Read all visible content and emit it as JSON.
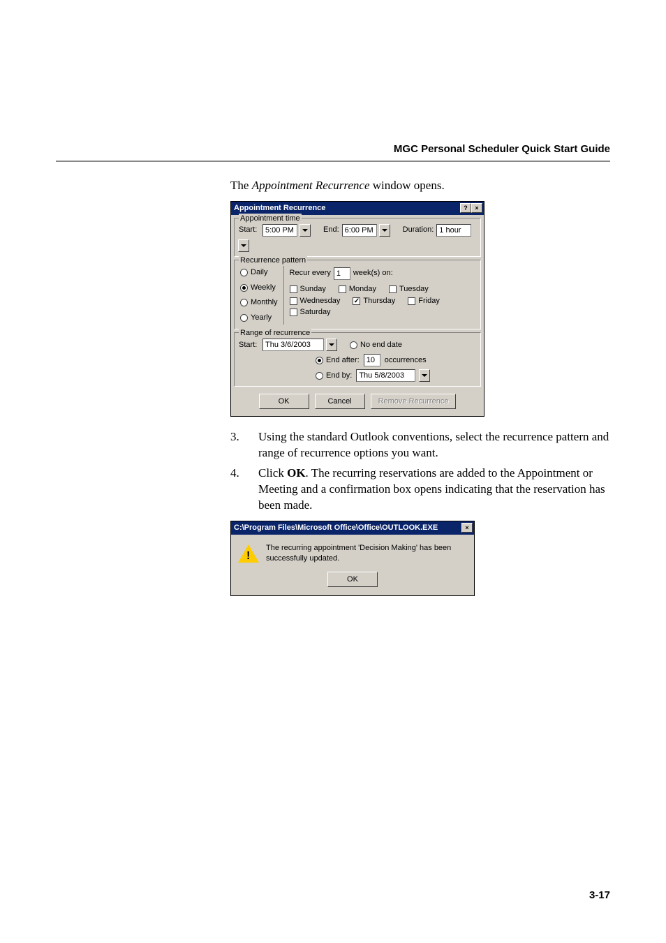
{
  "header": {
    "title": "MGC Personal Scheduler Quick Start Guide"
  },
  "intro": {
    "pre": "The ",
    "italic": "Appointment Recurrence",
    "post": " window opens."
  },
  "dialog1": {
    "title": "Appointment Recurrence",
    "appt": {
      "legend": "Appointment time",
      "startLabel": "Start:",
      "startValue": "5:00 PM",
      "endLabel": "End:",
      "endValue": "6:00 PM",
      "durationLabel": "Duration:",
      "durationValue": "1 hour"
    },
    "pattern": {
      "legend": "Recurrence pattern",
      "daily": "Daily",
      "weekly": "Weekly",
      "monthly": "Monthly",
      "yearly": "Yearly",
      "recurEvery": "Recur every",
      "recurN": "1",
      "weeksOn": "week(s) on:",
      "sunday": "Sunday",
      "monday": "Monday",
      "tuesday": "Tuesday",
      "wednesday": "Wednesday",
      "thursday": "Thursday",
      "friday": "Friday",
      "saturday": "Saturday"
    },
    "range": {
      "legend": "Range of recurrence",
      "startLabel": "Start:",
      "startValue": "Thu 3/6/2003",
      "noEnd": "No end date",
      "endAfter": "End after:",
      "endAfterN": "10",
      "occurrences": "occurrences",
      "endBy": "End by:",
      "endByValue": "Thu 5/8/2003"
    },
    "buttons": {
      "ok": "OK",
      "cancel": "Cancel",
      "remove": "Remove Recurrence"
    }
  },
  "steps": {
    "s3num": "3.",
    "s3text": "Using the standard Outlook conventions, select the recurrence pattern and range of recurrence options you want.",
    "s4num": "4.",
    "s4pre": "Click ",
    "s4bold": "OK",
    "s4post": ". The recurring reservations are added to the Appointment or Meeting and a confirmation box opens indicating that the reservation has been made."
  },
  "dialog2": {
    "title": "C:\\Program Files\\Microsoft Office\\Office\\OUTLOOK.EXE",
    "message": "The recurring appointment 'Decision Making' has been successfully updated.",
    "ok": "OK"
  },
  "pageNumber": "3-17"
}
